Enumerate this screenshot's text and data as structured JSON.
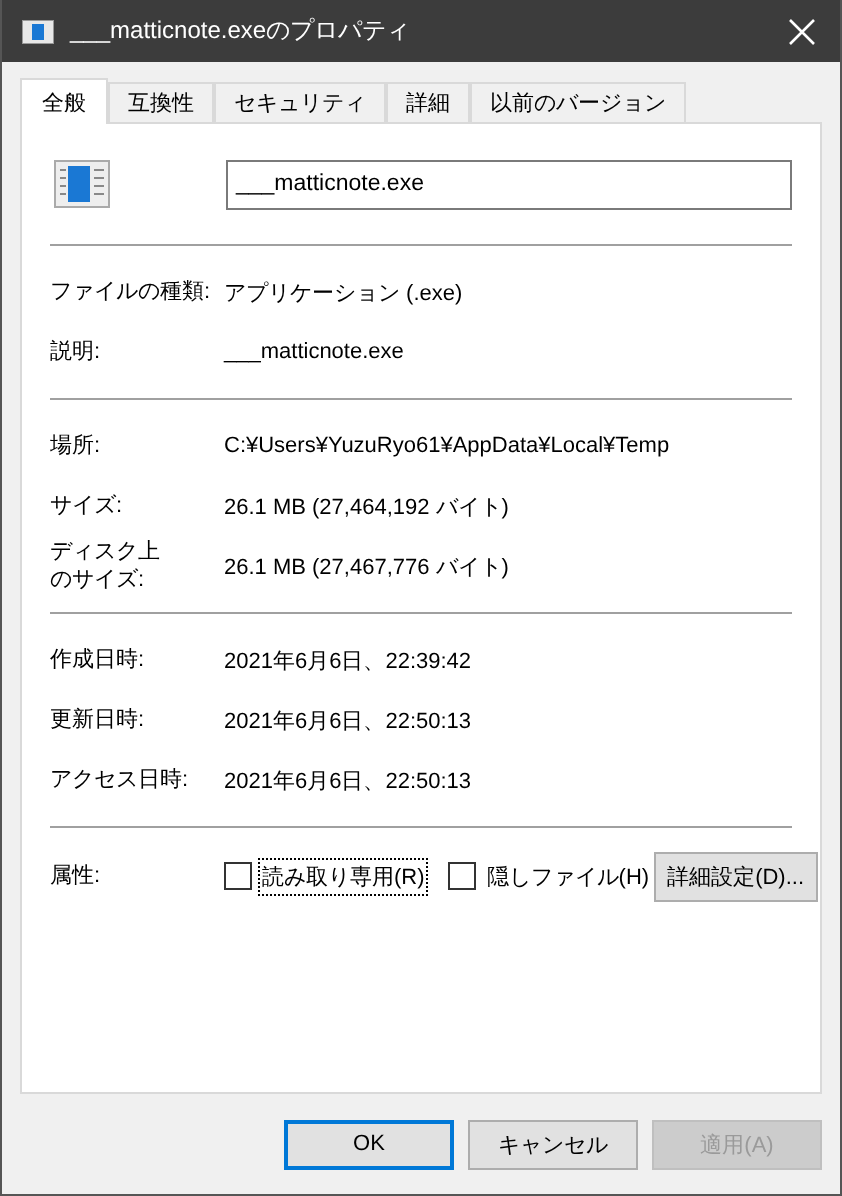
{
  "window": {
    "title": "___matticnote.exeのプロパティ"
  },
  "tabs": [
    {
      "label": "全般",
      "selected": true
    },
    {
      "label": "互換性",
      "selected": false
    },
    {
      "label": "セキュリティ",
      "selected": false
    },
    {
      "label": "詳細",
      "selected": false
    },
    {
      "label": "以前のバージョン",
      "selected": false
    }
  ],
  "name_field": {
    "value": "___matticnote.exe"
  },
  "sections": [
    [
      {
        "label": "ファイルの種類:",
        "value": "アプリケーション (.exe)"
      },
      {
        "label": "説明:",
        "value": "___matticnote.exe"
      }
    ],
    [
      {
        "label": "場所:",
        "value": "C:¥Users¥YuzuRyo61¥AppData¥Local¥Temp"
      },
      {
        "label": "サイズ:",
        "value": "26.1 MB (27,464,192 バイト)"
      },
      {
        "label": [
          "ディスク上",
          "のサイズ:"
        ],
        "value": "26.1 MB (27,467,776 バイト)"
      }
    ],
    [
      {
        "label": "作成日時:",
        "value": "2021年6月6日、22:39:42"
      },
      {
        "label": "更新日時:",
        "value": "2021年6月6日、22:50:13"
      },
      {
        "label": "アクセス日時:",
        "value": "2021年6月6日、22:50:13"
      }
    ]
  ],
  "attributes": {
    "label": "属性:",
    "checkboxes": [
      {
        "label": "読み取り専用(R)",
        "checked": false,
        "focused": true
      },
      {
        "label": "隠しファイル(H)",
        "checked": false,
        "focused": false
      }
    ],
    "button": "詳細設定(D)..."
  },
  "buttons": [
    {
      "label": "OK",
      "kind": "default",
      "disabled": false
    },
    {
      "label": "キャンセル",
      "kind": "normal",
      "disabled": false
    },
    {
      "label": "適用(A)",
      "kind": "normal",
      "disabled": true
    }
  ]
}
